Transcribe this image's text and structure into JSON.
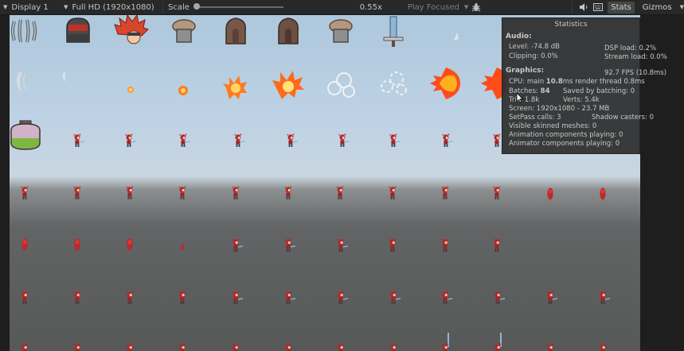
{
  "toolbar": {
    "display": "Display 1",
    "resolution": "Full HD (1920x1080)",
    "scale_label": "Scale",
    "scale_value": "0.55x",
    "play_focused": "Play Focused",
    "stats_button": "Stats",
    "gizmos_button": "Gizmos"
  },
  "stats": {
    "title": "Statistics",
    "audio_header": "Audio:",
    "level": "Level: -74.8 dB",
    "clipping": "Clipping: 0.0%",
    "dsp_load": "DSP load: 0.2%",
    "stream_load": "Stream load: 0.0%",
    "graphics_header": "Graphics:",
    "fps": "92.7 FPS (10.8ms)",
    "cpu_prefix": "CPU: main ",
    "cpu_main": "10.8",
    "cpu_suffix": "ms  render thread 0.8ms",
    "batches_prefix": "Batches: ",
    "batches": "84",
    "saved_batching": "Saved by batching: 0",
    "tris": "Tris: 1.8k",
    "verts": "Verts: 5.4k",
    "screen": "Screen: 1920x1080 - 23.7 MB",
    "setpass": "SetPass calls: 3",
    "shadow_casters": "Shadow casters: 0",
    "skinned_meshes": "Visible skinned meshes: 0",
    "anim_components": "Animation components playing: 0",
    "animator_components": "Animator components playing: 0"
  },
  "colors": {
    "toolbar_bg": "#282828",
    "stats_bg": "#303030",
    "sky_top": "#aec7dc",
    "ground": "#575858",
    "character_red": "#b3282c"
  },
  "scene": {
    "row1_sprites": [
      "bear-trap-icon",
      "red-chest-icon",
      "spiky-hair-head-icon",
      "stone-pillar-icon",
      "stone-tombstone-icon",
      "stone-tombstone-dark-icon",
      "stone-pillar-2-icon",
      "sword-icon",
      "sparkle-icon"
    ],
    "row2_sprites": [
      "slash-effect-icon",
      "slash-effect-small-icon",
      "spark-icon",
      "fire-small-icon",
      "fire-burst-icon",
      "explosion-icon",
      "smoke-cloud-icon",
      "smoke-puff-icon",
      "fireball-icon"
    ]
  }
}
